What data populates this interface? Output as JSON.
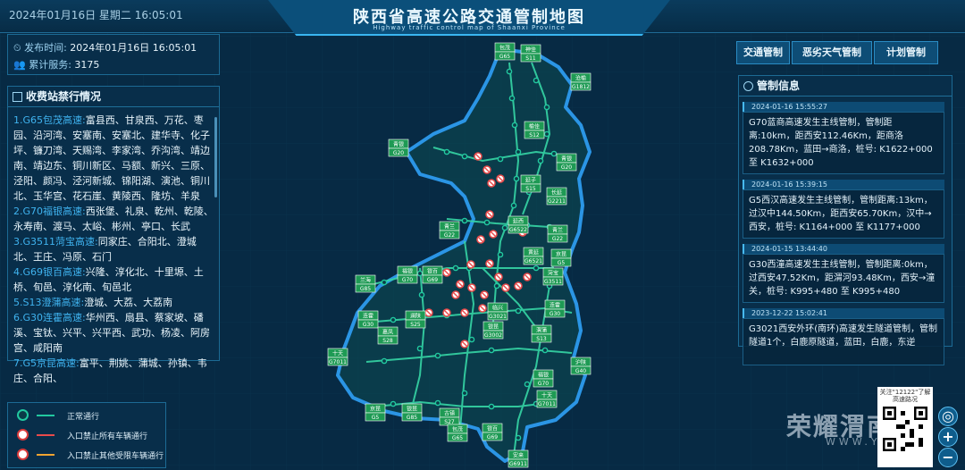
{
  "header": {
    "datetime": "2024年01月16日 星期二 16:05:01",
    "title": "陕西省高速公路交通管制地图",
    "subtitle": "Highway traffic control map of Shaanxi Province"
  },
  "info": {
    "publish_label": "发布时间:",
    "publish_value": "2024年01月16日 16:05:01",
    "service_label": "累计服务:",
    "service_value": "3175"
  },
  "closures": {
    "title": "收费站禁行情况",
    "items": [
      {
        "road": "1.G65包茂高速:",
        "stations": "富县西、甘泉西、万花、枣园、沿河湾、安塞南、安塞北、建华寺、化子坪、镰刀湾、天赐湾、李家湾、乔沟湾、靖边南、靖边东、铜川新区、马额、新兴、三原、泾阳、颜冯、泾河新城、锦阳湖、演池、铜川北、玉华宫、花石崖、黄陵西、隆坊、羊泉"
      },
      {
        "road": "2.G70福银高速:",
        "stations": "西张堡、礼泉、乾州、乾陵、永寿南、渡马、太峪、彬州、亭口、长武"
      },
      {
        "road": "3.G3511菏宝高速:",
        "stations": "同家庄、合阳北、澄城北、王庄、冯原、石门"
      },
      {
        "road": "4.G69银百高速:",
        "stations": "兴隆、淳化北、十里塬、土桥、旬邑、淳化南、旬邑北"
      },
      {
        "road": "5.S13澄蒲高速:",
        "stations": "澄城、大荔、大荔南"
      },
      {
        "road": "6.G30连霍高速:",
        "stations": "华州西、扇县、蔡家坡、磻溪、宝钛、兴平、兴平西、武功、杨凌、阿房宫、咸阳南"
      },
      {
        "road": "7.G5京昆高速:",
        "stations": "富平、荆姚、蒲城、孙镇、韦庄、合阳、"
      }
    ]
  },
  "legend": {
    "items": [
      {
        "label": "正常通行",
        "color": "#22c9a0"
      },
      {
        "label": "入口禁止所有车辆通行",
        "color": "#e84b4b"
      },
      {
        "label": "入口禁止其他受限车辆通行",
        "color": "#f0a431"
      }
    ]
  },
  "tabs": [
    "交通管制",
    "恶劣天气管制",
    "计划管制"
  ],
  "control_info": {
    "title": "管制信息",
    "items": [
      {
        "time": "2024-01-16 15:55:27",
        "text": "G70蓝商高速发生主线管制，管制距离:10km，距西安112.46Km，距商洛208.78Km，蓝田→商洛，桩号: K1622+000 至 K1632+000"
      },
      {
        "time": "2024-01-16 15:39:15",
        "text": "G5西汉高速发生主线管制，管制距离:13km，过汉中144.50Km，距西安65.70Km，汉中→西安，桩号: K1164+000 至 K1177+000"
      },
      {
        "time": "2024-01-15 13:44:40",
        "text": "G30西潼高速发生主线管制，管制距离:0km，过西安47.52Km，距渭河93.48Km，西安→潼关，桩号: K995+480 至 K995+480"
      },
      {
        "time": "2023-12-22 15:02:41",
        "text": "G3021西安外环(南环)高速发生隧道管制，管制隧道1个，白鹿原隧道，蓝田，白鹿，东逆"
      }
    ]
  },
  "map_shields": [
    {
      "name": "包茂",
      "code": "G65"
    },
    {
      "name": "神佳",
      "code": "S11"
    },
    {
      "name": "沧榆",
      "code": "G1812"
    },
    {
      "name": "青银",
      "code": "G20"
    },
    {
      "name": "榆佳",
      "code": "S12"
    },
    {
      "name": "青银",
      "code": "G20"
    },
    {
      "name": "延子",
      "code": "S15"
    },
    {
      "name": "长延",
      "code": "G2211"
    },
    {
      "name": "延西",
      "code": "G6522"
    },
    {
      "name": "青兰",
      "code": "G22"
    },
    {
      "name": "青兰",
      "code": "G22"
    },
    {
      "name": "黄延",
      "code": "G6521"
    },
    {
      "name": "京昆",
      "code": "G5"
    },
    {
      "name": "菏宝",
      "code": "G3511"
    },
    {
      "name": "福银",
      "code": "G70"
    },
    {
      "name": "银百",
      "code": "G69"
    },
    {
      "name": "兰海",
      "code": "G85"
    },
    {
      "name": "临兴",
      "code": "G3021"
    },
    {
      "name": "连霍",
      "code": "G30"
    },
    {
      "name": "连霍",
      "code": "G30"
    },
    {
      "name": "澜陕",
      "code": "S25"
    },
    {
      "name": "银昆",
      "code": "G3002"
    },
    {
      "name": "渭蒲",
      "code": "S13"
    },
    {
      "name": "嘉凤",
      "code": "S28"
    },
    {
      "name": "十天",
      "code": "G7011"
    },
    {
      "name": "沪陕",
      "code": "G40"
    },
    {
      "name": "福银",
      "code": "G70"
    },
    {
      "name": "十天",
      "code": "G7011"
    },
    {
      "name": "京昆",
      "code": "G5"
    },
    {
      "name": "银昆",
      "code": "G85"
    },
    {
      "name": "古镇",
      "code": "S27"
    },
    {
      "name": "包茂",
      "code": "G65"
    },
    {
      "name": "银百",
      "code": "G69"
    },
    {
      "name": "安来",
      "code": "G6911"
    }
  ],
  "qr": {
    "text": "关注\"12122\"了解高速路况"
  },
  "watermark": {
    "brand": "荣耀渭南",
    "url": "WWW.YEWN"
  },
  "controls": {
    "locate": "◎",
    "zoom_in": "+",
    "zoom_out": "−"
  }
}
